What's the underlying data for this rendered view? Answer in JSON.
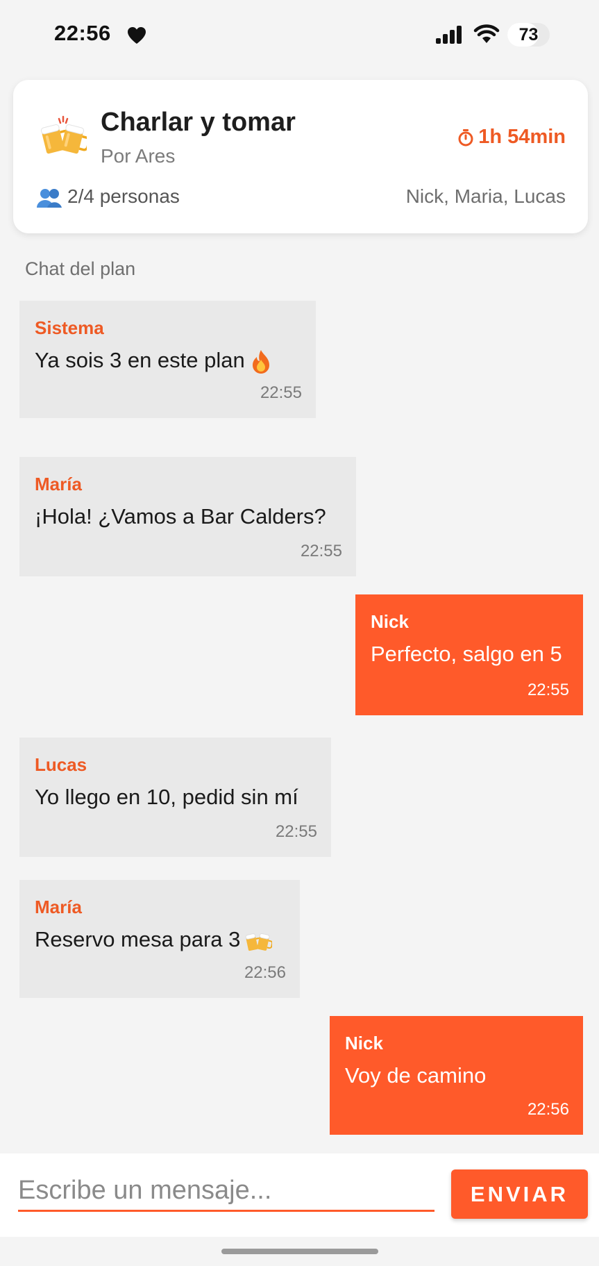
{
  "status_bar": {
    "time": "22:56",
    "battery": "73",
    "battery_level": 0.73,
    "icons": [
      "heart-icon",
      "signal-icon",
      "wifi-icon"
    ]
  },
  "plan": {
    "title": "Charlar y tomar",
    "author": "Por Ares",
    "timer": "1h 54min",
    "people": "2/4 personas",
    "members": "Nick, Maria, Lucas",
    "icons": [
      "beer-mugs-icon",
      "timer-icon",
      "people-icon"
    ]
  },
  "chat": {
    "label": "Chat del plan",
    "messages": [
      {
        "sender": "Sistema",
        "text": "Ya sois 3 en este plan",
        "time": "22:55",
        "emoji": "fire-icon"
      },
      {
        "sender": "María",
        "text": "¡Hola! ¿Vamos a Bar Calders?",
        "time": "22:55"
      },
      {
        "sender": "Nick",
        "text": "Perfecto, salgo en 5",
        "time": "22:55"
      },
      {
        "sender": "Lucas",
        "text": "Yo llego en 10, pedid sin mí",
        "time": "22:55"
      },
      {
        "sender": "María",
        "text": "Reservo mesa para 3",
        "time": "22:56",
        "emoji": "beer-mugs-icon"
      },
      {
        "sender": "Nick",
        "text": "Voy de camino",
        "time": "22:56"
      }
    ]
  },
  "input": {
    "placeholder": "Escribe un mensaje...",
    "value": "",
    "send_label": "ENVIAR"
  },
  "colors": {
    "accent": "#ff5a2a",
    "accent_text": "#ee5a24",
    "incoming_bubble": "#e9e9e9",
    "background": "#f4f4f4"
  }
}
